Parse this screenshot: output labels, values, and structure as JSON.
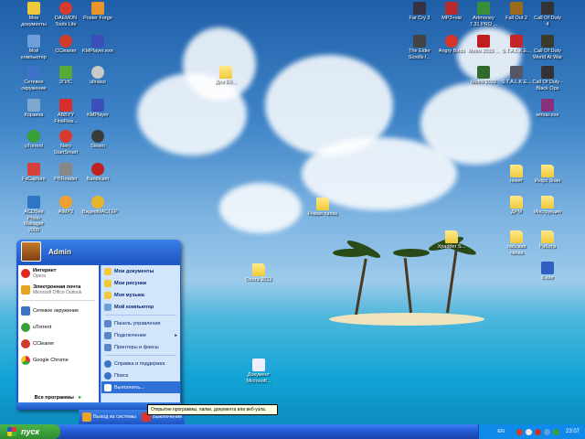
{
  "desktop_icons": [
    {
      "id": "my-docs",
      "label": "Мои документы"
    },
    {
      "id": "daemon",
      "label": "DAEMON Tools Lite"
    },
    {
      "id": "poster-forge",
      "label": "Poster Forge"
    },
    {
      "id": "my-computer",
      "label": "Мой компьютер"
    },
    {
      "id": "ccleaner",
      "label": "CCleaner"
    },
    {
      "id": "kmplayer-exe",
      "label": "KMPlayer.exe"
    },
    {
      "id": "network",
      "label": "Сетевое окружение"
    },
    {
      "id": "2gis",
      "label": "2ГИС"
    },
    {
      "id": "ultraiso",
      "label": "ultraiso"
    },
    {
      "id": "recycle",
      "label": "Корзина"
    },
    {
      "id": "abbyy",
      "label": "ABBYY FineRea..."
    },
    {
      "id": "kmplayer",
      "label": "KMPlayer"
    },
    {
      "id": "utorrent",
      "label": "uTorrent"
    },
    {
      "id": "nero",
      "label": "Nero StartSmart"
    },
    {
      "id": "steam",
      "label": "Steam"
    },
    {
      "id": "fscapture",
      "label": "FsCapture"
    },
    {
      "id": "pbreader",
      "label": "PBReader"
    },
    {
      "id": "bandicam",
      "label": "Bandicam"
    },
    {
      "id": "acdsee",
      "label": "ACDSee Photo Manager 2009"
    },
    {
      "id": "aimp",
      "label": "AIMP2"
    },
    {
      "id": "videomaster",
      "label": "ВидеоМАСТЕР"
    },
    {
      "id": "farcry3",
      "label": "Far Cry 3"
    },
    {
      "id": "mp3",
      "label": "MP3+vai"
    },
    {
      "id": "artmoney",
      "label": "Artmoney 7.31 PRO ..."
    },
    {
      "id": "fallout2",
      "label": "Fall Out 2"
    },
    {
      "id": "cod4",
      "label": "Call Of Duty 4"
    },
    {
      "id": "folder-top",
      "label": "Для Еб..."
    },
    {
      "id": "elder-scrolls",
      "label": "The Elder Scrolls I..."
    },
    {
      "id": "angry-birds",
      "label": "Angry Birds"
    },
    {
      "id": "metro2033-a",
      "label": "Metro 2033 ..."
    },
    {
      "id": "stalker-icon",
      "label": "S.T.A.L.K.E..."
    },
    {
      "id": "cod-waw",
      "label": "Call Of Duty World At War"
    },
    {
      "id": "metro2033",
      "label": "Metro 2033"
    },
    {
      "id": "stalker",
      "label": "S.T.A.L.K.E..."
    },
    {
      "id": "cod-bo",
      "label": "Call Of Duty - Black Ops"
    },
    {
      "id": "winrar",
      "label": "winrar.exe"
    },
    {
      "id": "nekit",
      "label": "некит"
    },
    {
      "id": "info",
      "label": "Инфо Знан"
    },
    {
      "id": "drm",
      "label": "ДРМ"
    },
    {
      "id": "instr",
      "label": "Инструкция"
    },
    {
      "id": "xradder",
      "label": "Xpadder S..."
    },
    {
      "id": "lab",
      "label": "лабская папка"
    },
    {
      "id": "rabota",
      "label": "Работа"
    },
    {
      "id": "help",
      "label": "6.exe"
    },
    {
      "id": "nudes",
      "label": "Новая папка"
    },
    {
      "id": "ohota",
      "label": "Охота 2012"
    },
    {
      "id": "doc",
      "label": "Документ Microsoft..."
    }
  ],
  "start_menu": {
    "username": "Admin",
    "pinned": [
      {
        "label": "Интернет",
        "sub": "Opera",
        "color": "#e0281f"
      },
      {
        "label": "Электронная почта",
        "sub": "Microsoft Office Outlook",
        "color": "#e9a21c"
      }
    ],
    "recent": [
      {
        "label": "Сетевое окружение",
        "sub": "",
        "color": "#3c73c9"
      },
      {
        "label": "uTorrent",
        "sub": "",
        "color": "#39a038"
      },
      {
        "label": "CCleaner",
        "sub": "",
        "color": "#d03b2a"
      },
      {
        "label": "Google Chrome",
        "sub": "",
        "color": "#e8b21b"
      }
    ],
    "all_programs": "Все программы",
    "right_items": [
      {
        "label": "Мои документы",
        "color": "#f0c93a"
      },
      {
        "label": "Мои рисунки",
        "color": "#f0c93a"
      },
      {
        "label": "Моя музыка",
        "color": "#f0c93a"
      },
      {
        "label": "Мой компьютер",
        "color": "#6f9fd8"
      },
      {
        "label": "Панель управления",
        "color": "#5a86c8"
      },
      {
        "label": "Подключение",
        "color": "#5a86c8"
      },
      {
        "label": "Принтеры и факсы",
        "color": "#5a86c8"
      },
      {
        "label": "Справка и поддержка",
        "color": "#3c73c9"
      },
      {
        "label": "Поиск",
        "color": "#3c73c9"
      },
      {
        "label": "Выполнить...",
        "color": "#3c73c9"
      }
    ],
    "logoff": "Выход из системы",
    "shutdown": "Выключение"
  },
  "tooltip": "Открытие программы, папки, документа или веб-узла.",
  "taskbar": {
    "start_label": "пуск",
    "language": "EN",
    "clock": "23:07"
  }
}
